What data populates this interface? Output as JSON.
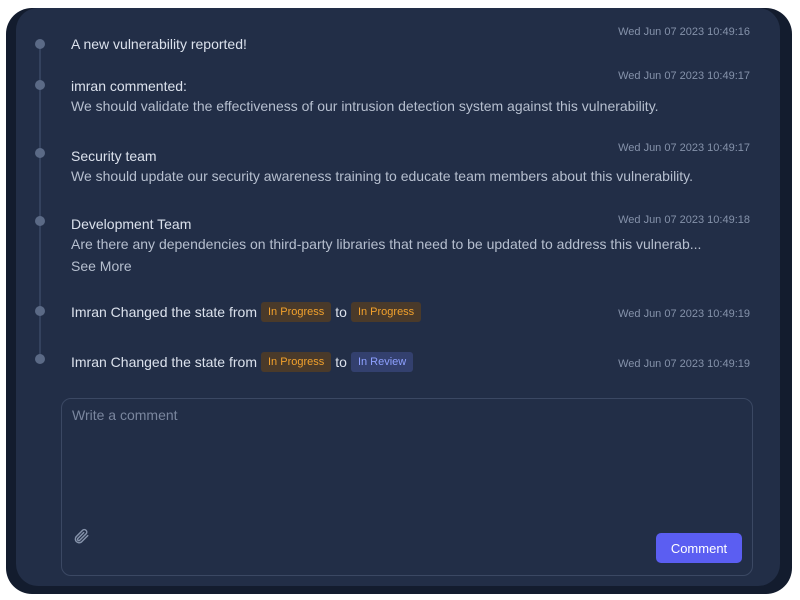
{
  "activity": [
    {
      "type": "event",
      "title": "A new vulnerability reported!",
      "time": "Wed Jun 07 2023 10:49:16"
    },
    {
      "type": "comment",
      "author": "imran commented:",
      "body": "We should validate the effectiveness of our intrusion detection system against this vulnerability.",
      "time": "Wed Jun 07 2023 10:49:17"
    },
    {
      "type": "comment",
      "author": "Security team",
      "body": "We should update our security awareness training to educate team members about this vulnerability.",
      "time": "Wed Jun 07 2023 10:49:17"
    },
    {
      "type": "comment",
      "author": "Development Team",
      "body": "Are there any dependencies on third-party libraries that need to be updated to address this vulnerab...",
      "see_more": "See More",
      "time": "Wed Jun 07 2023 10:49:18"
    },
    {
      "type": "state",
      "prefix": "Imran Changed the state from",
      "from": "In Progress",
      "to_word": "to",
      "to": "In Progress",
      "time": "Wed Jun 07 2023 10:49:19"
    },
    {
      "type": "state",
      "prefix": "Imran Changed the state from",
      "from": "In Progress",
      "to_word": "to",
      "to": "In Review",
      "time": "Wed Jun 07 2023 10:49:19"
    }
  ],
  "comment_box": {
    "placeholder": "Write a comment",
    "attach_icon": "paperclip-icon",
    "submit_label": "Comment"
  },
  "colors": {
    "accent": "#5b5ef2",
    "in_progress": "#f2a12c",
    "in_review": "#8ea0ff"
  }
}
